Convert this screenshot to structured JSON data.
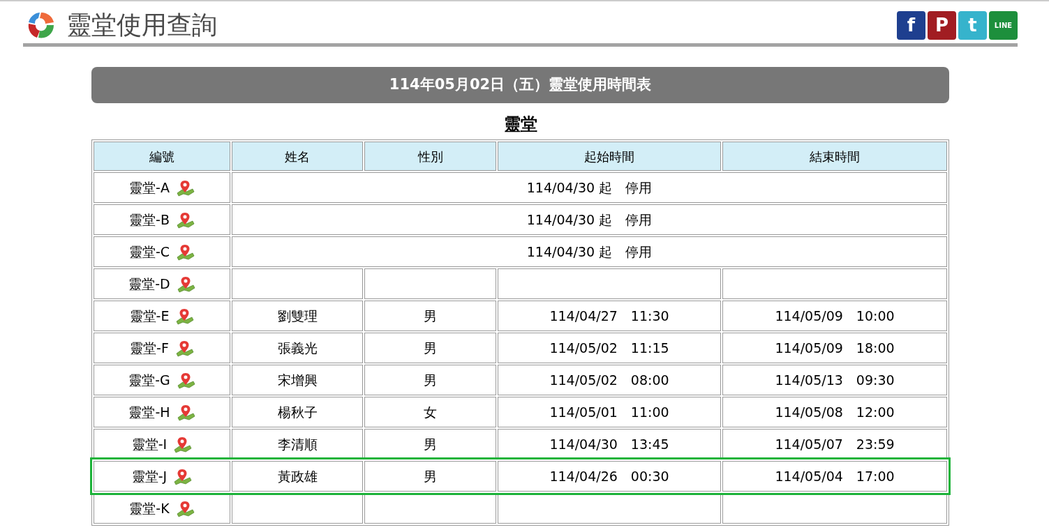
{
  "header": {
    "title": "靈堂使用查詢",
    "social": [
      "f",
      "P",
      "t",
      "LINE"
    ]
  },
  "banner": "114年05月02日（五）靈堂使用時間表",
  "table": {
    "caption": "靈堂",
    "columns": [
      "編號",
      "姓名",
      "性別",
      "起始時間",
      "結束時間"
    ],
    "rows": [
      {
        "kind": "suspended",
        "id": "靈堂-A",
        "note": "114/04/30 起　停用",
        "highlighted": false
      },
      {
        "kind": "suspended",
        "id": "靈堂-B",
        "note": "114/04/30 起　停用",
        "highlighted": false
      },
      {
        "kind": "suspended",
        "id": "靈堂-C",
        "note": "114/04/30 起　停用",
        "highlighted": false
      },
      {
        "kind": "normal",
        "id": "靈堂-D",
        "name": "",
        "gender": "",
        "start": "",
        "end": "",
        "highlighted": false
      },
      {
        "kind": "normal",
        "id": "靈堂-E",
        "name": "劉雙理",
        "gender": "男",
        "start": "114/04/27　11:30",
        "end": "114/05/09　10:00",
        "highlighted": false
      },
      {
        "kind": "normal",
        "id": "靈堂-F",
        "name": "張義光",
        "gender": "男",
        "start": "114/05/02　11:15",
        "end": "114/05/09　18:00",
        "highlighted": false
      },
      {
        "kind": "normal",
        "id": "靈堂-G",
        "name": "宋增興",
        "gender": "男",
        "start": "114/05/02　08:00",
        "end": "114/05/13　09:30",
        "highlighted": false
      },
      {
        "kind": "normal",
        "id": "靈堂-H",
        "name": "楊秋子",
        "gender": "女",
        "start": "114/05/01　11:00",
        "end": "114/05/08　12:00",
        "highlighted": false
      },
      {
        "kind": "normal",
        "id": "靈堂-I",
        "name": "李清順",
        "gender": "男",
        "start": "114/04/30　13:45",
        "end": "114/05/07　23:59",
        "highlighted": false
      },
      {
        "kind": "normal",
        "id": "靈堂-J",
        "name": "黃政雄",
        "gender": "男",
        "start": "114/04/26　00:30",
        "end": "114/05/04　17:00",
        "highlighted": true
      },
      {
        "kind": "normal",
        "id": "靈堂-K",
        "name": "",
        "gender": "",
        "start": "",
        "end": "",
        "highlighted": false
      }
    ]
  }
}
